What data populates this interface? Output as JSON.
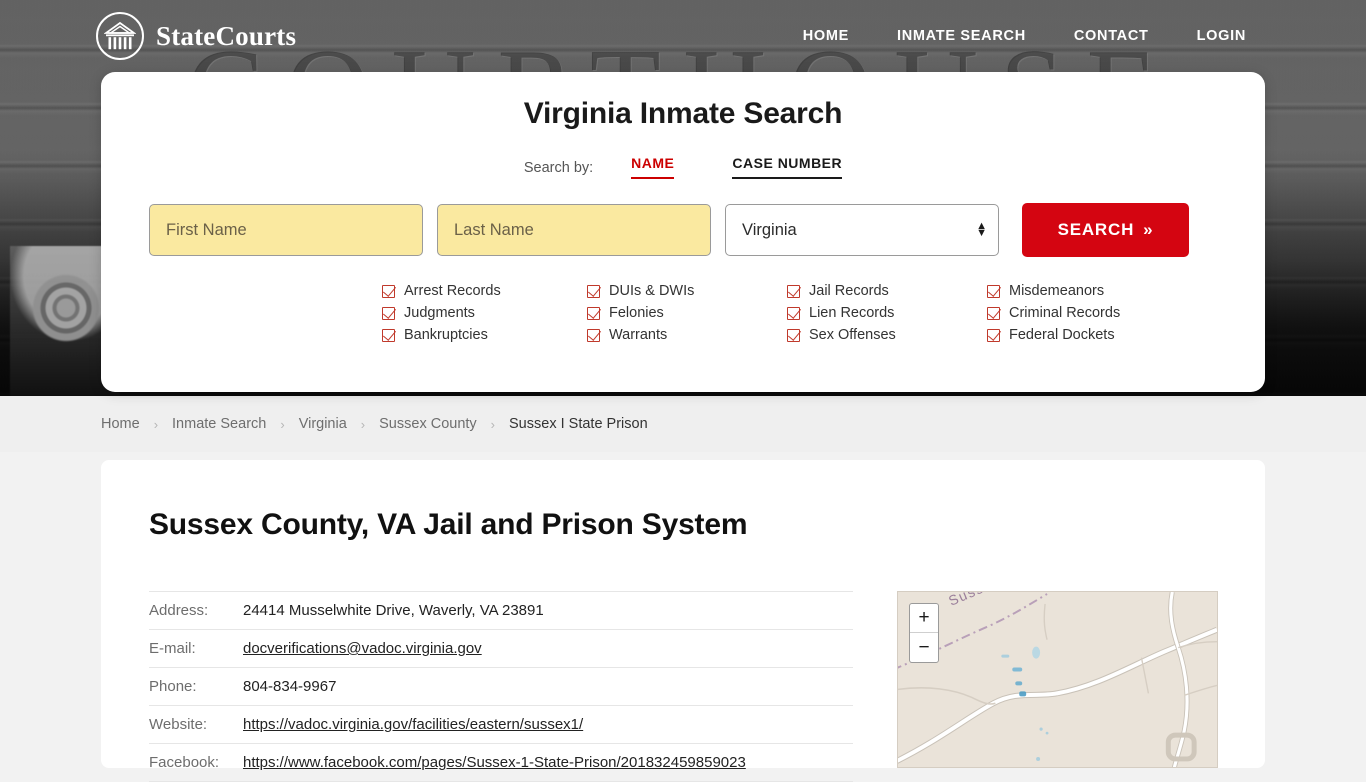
{
  "header": {
    "brand_name": "StateCourts",
    "logo_icon": "courthouse-circle-icon",
    "nav": [
      {
        "label": "HOME"
      },
      {
        "label": "INMATE SEARCH"
      },
      {
        "label": "CONTACT"
      },
      {
        "label": "LOGIN"
      }
    ]
  },
  "hero": {
    "background_word": "COURTHOUSE"
  },
  "search": {
    "title": "Virginia Inmate Search",
    "search_by_label": "Search by:",
    "tabs": [
      {
        "label": "NAME",
        "active": true,
        "color": "#cc0000"
      },
      {
        "label": "CASE NUMBER",
        "active": false,
        "color": "#1a1a1a"
      }
    ],
    "first_name_placeholder": "First Name",
    "first_name_value": "",
    "last_name_placeholder": "Last Name",
    "last_name_value": "",
    "state_selected": "Virginia",
    "submit_label": "SEARCH",
    "submit_icon": "double-chevron-right-icon",
    "field_fill": "#fae9a0",
    "button_color": "#d40511",
    "checks": [
      "Arrest Records",
      "DUIs & DWIs",
      "Jail Records",
      "Misdemeanors",
      "Judgments",
      "Felonies",
      "Lien Records",
      "Criminal Records",
      "Bankruptcies",
      "Warrants",
      "Sex Offenses",
      "Federal Dockets"
    ]
  },
  "breadcrumb": {
    "separator": "›",
    "items": [
      {
        "label": "Home",
        "current": false
      },
      {
        "label": "Inmate Search",
        "current": false
      },
      {
        "label": "Virginia",
        "current": false
      },
      {
        "label": "Sussex County",
        "current": false
      },
      {
        "label": "Sussex I State Prison",
        "current": true
      }
    ]
  },
  "main": {
    "title": "Sussex County, VA Jail and Prison System",
    "details": [
      {
        "label": "Address:",
        "value": "24414 Musselwhite Drive, Waverly, VA 23891",
        "link": false
      },
      {
        "label": "E-mail:",
        "value": "docverifications@vadoc.virginia.gov",
        "link": true
      },
      {
        "label": "Phone:",
        "value": "804-834-9967",
        "link": false
      },
      {
        "label": "Website:",
        "value": "https://vadoc.virginia.gov/facilities/eastern/sussex1/",
        "link": true
      },
      {
        "label": "Facebook:",
        "value": "https://www.facebook.com/pages/Sussex-1-State-Prison/201832459859023",
        "link": true
      }
    ]
  },
  "map": {
    "zoom_in_label": "+",
    "zoom_out_label": "−",
    "county_label": "Sussex County"
  }
}
